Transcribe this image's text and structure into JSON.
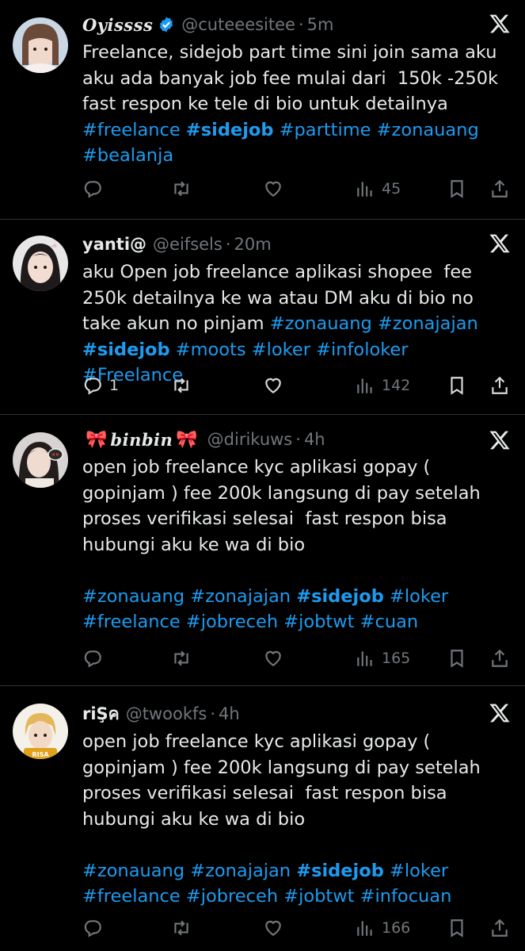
{
  "tweets": [
    {
      "name": "𝑶𝒚𝒊𝒔𝒔𝒔𝒔",
      "verified": true,
      "handle": "@cuteeesitee",
      "time": "5m",
      "text_plain": "Freelance, sidejob part time sini join sama aku aku ada banyak job fee mulai dari  150k -250k fast respon ke tele di bio untuk detailnya",
      "tags": [
        "#freelance",
        "#sidejob",
        "#parttime",
        "#zonauang",
        "#bealanja"
      ],
      "replies": "",
      "views": "45"
    },
    {
      "name": "yanti@",
      "verified": false,
      "handle": "@eifsels",
      "time": "20m",
      "text_plain": "aku Open job freelance aplikasi shopee  fee 250k detailnya ke wa atau DM aku di bio no take akun no pinjam",
      "tags": [
        "#zonauang",
        "#zonajajan",
        "#sidejob",
        "#moots",
        "#loker",
        "#infoloker",
        "#Freelance"
      ],
      "replies": "1",
      "views": "142"
    },
    {
      "name": "𝒃𝒊𝒏𝒃𝒊𝒏",
      "bow": "🎀",
      "verified": false,
      "handle": "@dirikuws",
      "time": "4h",
      "text_plain": "open job freelance kyc aplikasi gopay ( gopinjam ) fee 200k langsung di pay setelah proses verifikasi selesai  fast respon bisa hubungi aku ke wa di bio",
      "tags": [
        "#zonauang",
        "#zonajajan",
        "#sidejob",
        "#loker",
        "#freelance",
        "#jobreceh",
        "#jobtwt",
        "#cuan"
      ],
      "replies": "",
      "views": "165"
    },
    {
      "name": "riŞค",
      "verified": false,
      "handle": "@twookfs",
      "time": "4h",
      "text_plain": "open job freelance kyc aplikasi gopay ( gopinjam ) fee 200k langsung di pay setelah proses verifikasi selesai  fast respon bisa hubungi aku ke wa di bio",
      "tags": [
        "#zonauang",
        "#zonajajan",
        "#sidejob",
        "#loker",
        "#freelance",
        "#jobreceh",
        "#jobtwt",
        "#infocuan"
      ],
      "replies": "",
      "views": "166"
    }
  ],
  "icons": {
    "reply": "reply-icon",
    "retweet": "retweet-icon",
    "like": "heart-icon",
    "views": "views-icon",
    "bookmark": "bookmark-icon",
    "share": "share-icon",
    "brand": "x-logo-icon"
  },
  "colors": {
    "background": "#000000",
    "text": "#e7e9ea",
    "muted": "#71767b",
    "link": "#1d9bf0",
    "divider": "#2f3336",
    "verified": "#1d9bf0"
  }
}
